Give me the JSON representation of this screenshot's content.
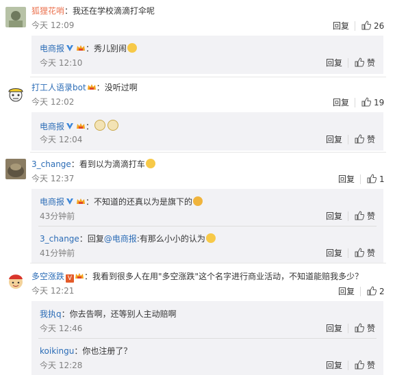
{
  "comments": [
    {
      "user": "狐狸花哨",
      "sep": "：",
      "text": "我还在学校滴滴打伞呢",
      "time": "今天 12:09",
      "reply_label": "回复",
      "like_count": "26",
      "subs": [
        {
          "user": "电商报",
          "sep": "：",
          "text": "秀儿别闹",
          "time": "今天 12:10",
          "reply_label": "回复",
          "like_label": "赞"
        }
      ]
    },
    {
      "user": "打工人语录bot",
      "sep": "：",
      "text": "没听过啊",
      "time": "今天 12:02",
      "reply_label": "回复",
      "like_count": "19",
      "subs": [
        {
          "user": "电商报",
          "sep": "：",
          "text": "",
          "time": "今天 12:04",
          "reply_label": "回复",
          "like_label": "赞"
        }
      ]
    },
    {
      "user": "3_change",
      "sep": "：",
      "text": "看到以为滴滴打车",
      "time": "今天 12:37",
      "reply_label": "回复",
      "like_count": "1",
      "subs": [
        {
          "user": "电商报",
          "sep": "：",
          "text": "不知道的还真以为是旗下的",
          "time": "43分钟前",
          "reply_label": "回复",
          "like_label": "赞"
        },
        {
          "user": "3_change",
          "sep": "：",
          "reply_word": "回复",
          "mention": "@电商报",
          "text": ":有那么小小的认为",
          "time": "41分钟前",
          "reply_label": "回复",
          "like_label": "赞"
        }
      ]
    },
    {
      "user": "多空涨跌",
      "sep": "：",
      "text": "我看到很多人在用\"多空涨跌\"这个名字进行商业活动，不知道能赔我多少？",
      "time": "今天 12:21",
      "reply_label": "回复",
      "like_count": "2",
      "subs": [
        {
          "user": "我执q",
          "sep": "：",
          "text": "你去告啊，还等别人主动赔啊",
          "time": "今天 12:46",
          "reply_label": "回复",
          "like_label": "赞"
        },
        {
          "user": "koikingu",
          "sep": "：",
          "text": "你也注册了？",
          "time": "今天 12:28",
          "reply_label": "回复",
          "like_label": "赞"
        }
      ]
    }
  ],
  "colors": {
    "username": "#eb7350",
    "link_blue": "#2b6cb6",
    "time_gray": "#808080",
    "sub_bg": "#f2f2f5"
  },
  "icons": {
    "like": "thumbs-up-icon",
    "verified": "verified-v-icon",
    "member": "crown-icon"
  }
}
